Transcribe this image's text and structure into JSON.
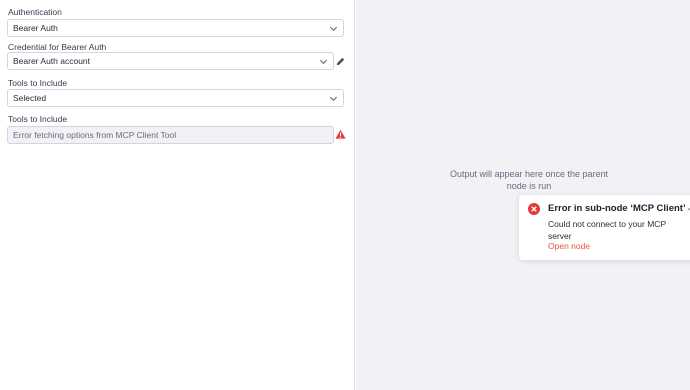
{
  "form": {
    "auth": {
      "label": "Authentication",
      "value": "Bearer Auth"
    },
    "credential": {
      "label": "Credential for Bearer Auth",
      "value": "Bearer Auth account"
    },
    "tools": {
      "label": "Tools to Include",
      "value": "Selected"
    },
    "tools_error": {
      "label": "Tools to Include",
      "value": "Error fetching options from MCP Client Tool"
    }
  },
  "output": {
    "placeholder": "Output will appear here once the parent node is run"
  },
  "toast": {
    "title": "Error in sub-node ‘MCP Client’",
    "message": "Could not connect to your MCP server",
    "link": "Open node",
    "close": "×"
  },
  "colors": {
    "error": "#e5383b",
    "link": "#e8533f",
    "panel_bg": "#f1f1f6"
  },
  "icons": {
    "edit": "pencil-icon",
    "warning": "warning-triangle-icon",
    "error": "error-circle-icon"
  }
}
